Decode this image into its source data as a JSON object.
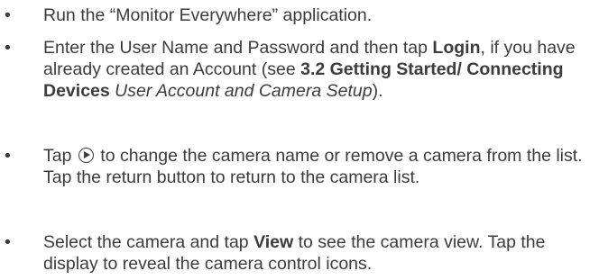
{
  "bullet_char": "•",
  "items": [
    {
      "text": "Run the “Monitor Everywhere” application."
    },
    {
      "t1": "Enter the User Name and Password and then tap ",
      "b1": "Login",
      "t2": ", if you have already created an Account (see ",
      "b2": "3.2 Getting Started/ Connecting Devices",
      "t3": " ",
      "i1": "User Account and Camera Setup",
      "t4": ")."
    },
    {
      "t1": "Tap ",
      "icon": "play-circle-icon",
      "t2": " to change the camera name or remove a camera from the list. Tap the return button to return to the camera list."
    },
    {
      "t1": "Select the camera and tap ",
      "b1": "View",
      "t2": " to see the camera view. Tap the display to reveal the camera control icons."
    }
  ]
}
